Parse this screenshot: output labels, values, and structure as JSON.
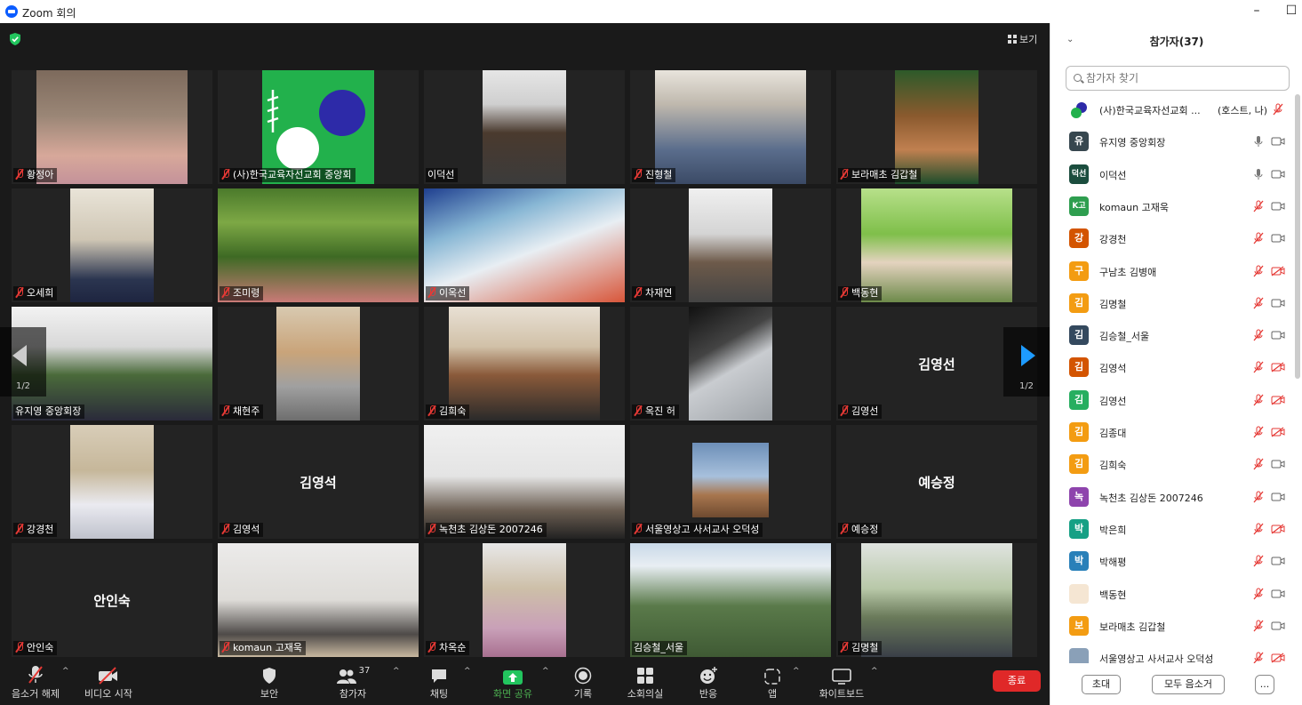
{
  "window": {
    "title": "Zoom 회의",
    "minimize_icon": "minimize-icon",
    "maximize_icon": "maximize-icon"
  },
  "view_button": {
    "label": "보기"
  },
  "pager": {
    "left_page": "1/2",
    "right_page": "1/2"
  },
  "tiles": [
    {
      "name": "황정아",
      "big": "",
      "mic_muted": true,
      "active": false
    },
    {
      "name": "(사)한국교육자선교회 중앙회",
      "big": "",
      "mic_muted": true,
      "active": false
    },
    {
      "name": "이덕선",
      "big": "",
      "mic_muted": false,
      "active": false
    },
    {
      "name": "진형철",
      "big": "",
      "mic_muted": true,
      "active": false
    },
    {
      "name": "보라매초 김갑철",
      "big": "",
      "mic_muted": true,
      "active": false
    },
    {
      "name": "오세희",
      "big": "",
      "mic_muted": true,
      "active": false
    },
    {
      "name": "조미령",
      "big": "",
      "mic_muted": true,
      "active": false
    },
    {
      "name": "이옥선",
      "big": "",
      "mic_muted": true,
      "active": false
    },
    {
      "name": "차재연",
      "big": "",
      "mic_muted": true,
      "active": false
    },
    {
      "name": "백동현",
      "big": "",
      "mic_muted": true,
      "active": false
    },
    {
      "name": "유지영 중앙회장",
      "big": "",
      "mic_muted": false,
      "active": true
    },
    {
      "name": "채현주",
      "big": "",
      "mic_muted": true,
      "active": false
    },
    {
      "name": "김희숙",
      "big": "",
      "mic_muted": true,
      "active": false
    },
    {
      "name": "옥진 허",
      "big": "",
      "mic_muted": true,
      "active": false
    },
    {
      "name": "김영선",
      "big": "김영선",
      "mic_muted": true,
      "active": false
    },
    {
      "name": "강경천",
      "big": "",
      "mic_muted": true,
      "active": false
    },
    {
      "name": "김영석",
      "big": "김영석",
      "mic_muted": true,
      "active": false
    },
    {
      "name": "녹천초 김상돈 2007246",
      "big": "",
      "mic_muted": true,
      "active": false
    },
    {
      "name": "서울영상고 사서교사 오덕성",
      "big": "",
      "mic_muted": true,
      "active": false
    },
    {
      "name": "예승정",
      "big": "예승정",
      "mic_muted": true,
      "active": false
    },
    {
      "name": "안인숙",
      "big": "안인숙",
      "mic_muted": true,
      "active": false
    },
    {
      "name": "komaun 고재욱",
      "big": "",
      "mic_muted": true,
      "active": false
    },
    {
      "name": "차옥순",
      "big": "",
      "mic_muted": true,
      "active": false
    },
    {
      "name": "김승철_서울",
      "big": "",
      "mic_muted": false,
      "active": false
    },
    {
      "name": "김명철",
      "big": "",
      "mic_muted": true,
      "active": false
    }
  ],
  "toolbar": {
    "unmute": "음소거 해제",
    "start_video": "비디오 시작",
    "security": "보안",
    "participants": "참가자",
    "participants_count": "37",
    "chat": "채팅",
    "share": "화면 공유",
    "record": "기록",
    "breakout": "소회의실",
    "reactions": "반응",
    "apps": "앱",
    "whiteboard": "화이트보드",
    "end": "종료"
  },
  "panel": {
    "title": "참가자(37)",
    "search_placeholder": "참가자 찾기",
    "participants": [
      {
        "initials": "",
        "name": "(사)한국교육자선교회 ...",
        "role": "(호스트, 나)",
        "color": "#ffffff",
        "mic": "muted",
        "cam": "none"
      },
      {
        "initials": "유",
        "name": "유지영 중앙회장",
        "role": "",
        "color": "#37474f",
        "mic": "on",
        "cam": "on"
      },
      {
        "initials": "덕선",
        "name": "이덕선",
        "role": "",
        "color": "#1b4d3e",
        "mic": "on",
        "cam": "on"
      },
      {
        "initials": "K고",
        "name": "komaun 고재욱",
        "role": "",
        "color": "#2e9e4f",
        "mic": "muted",
        "cam": "on"
      },
      {
        "initials": "강",
        "name": "강경천",
        "role": "",
        "color": "#d35400",
        "mic": "muted",
        "cam": "on"
      },
      {
        "initials": "구",
        "name": "구남초 김병애",
        "role": "",
        "color": "#f39c12",
        "mic": "muted",
        "cam": "off"
      },
      {
        "initials": "김",
        "name": "김명철",
        "role": "",
        "color": "#f39c12",
        "mic": "muted",
        "cam": "on"
      },
      {
        "initials": "김",
        "name": "김승철_서울",
        "role": "",
        "color": "#34495e",
        "mic": "muted",
        "cam": "on"
      },
      {
        "initials": "김",
        "name": "김영석",
        "role": "",
        "color": "#d35400",
        "mic": "muted",
        "cam": "off"
      },
      {
        "initials": "김",
        "name": "김영선",
        "role": "",
        "color": "#27ae60",
        "mic": "muted",
        "cam": "off"
      },
      {
        "initials": "김",
        "name": "김종대",
        "role": "",
        "color": "#f39c12",
        "mic": "muted",
        "cam": "off"
      },
      {
        "initials": "김",
        "name": "김희숙",
        "role": "",
        "color": "#f39c12",
        "mic": "muted",
        "cam": "on"
      },
      {
        "initials": "녹",
        "name": "녹천초 김상돈 2007246",
        "role": "",
        "color": "#8e44ad",
        "mic": "muted",
        "cam": "on"
      },
      {
        "initials": "박",
        "name": "박은희",
        "role": "",
        "color": "#16a085",
        "mic": "muted",
        "cam": "off"
      },
      {
        "initials": "박",
        "name": "박해평",
        "role": "",
        "color": "#2980b9",
        "mic": "muted",
        "cam": "on"
      },
      {
        "initials": "",
        "name": "백동현",
        "role": "",
        "color": "#f5e6d3",
        "mic": "muted",
        "cam": "on"
      },
      {
        "initials": "보",
        "name": "보라매초 김갑철",
        "role": "",
        "color": "#f39c12",
        "mic": "muted",
        "cam": "on"
      },
      {
        "initials": "",
        "name": "서울영상고 사서교사 오덕성",
        "role": "",
        "color": "#8aa0b8",
        "mic": "muted",
        "cam": "off"
      }
    ],
    "invite": "초대",
    "mute_all": "모두 음소거",
    "more": "..."
  }
}
